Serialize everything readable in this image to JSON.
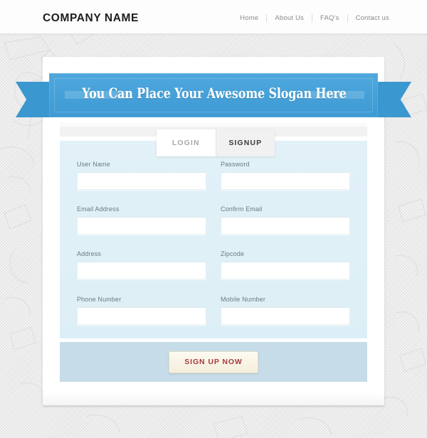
{
  "header": {
    "logo": "COMPANY NAME",
    "nav": [
      {
        "label": "Home"
      },
      {
        "label": "About Us"
      },
      {
        "label": "FAQ's"
      },
      {
        "label": "Contact us"
      }
    ]
  },
  "ribbon": {
    "slogan": "You Can Place Your Awesome Slogan Here",
    "color": "#4aa3da",
    "fold_color": "#2b76a5"
  },
  "tabs": [
    {
      "label": "LOGIN",
      "active": false
    },
    {
      "label": "SIGNUP",
      "active": true
    }
  ],
  "form": {
    "panel_color": "#dff0f7",
    "fields": [
      {
        "label": "User Name",
        "value": "",
        "placeholder": ""
      },
      {
        "label": "Password",
        "value": "",
        "placeholder": ""
      },
      {
        "label": "Email Address",
        "value": "",
        "placeholder": ""
      },
      {
        "label": "Confirm Email",
        "value": "",
        "placeholder": ""
      },
      {
        "label": "Address",
        "value": "",
        "placeholder": ""
      },
      {
        "label": "Zipcode",
        "value": "",
        "placeholder": ""
      },
      {
        "label": "Phone Number",
        "value": "",
        "placeholder": ""
      },
      {
        "label": "Mobile Number",
        "value": "",
        "placeholder": ""
      }
    ]
  },
  "actions": {
    "submit_label": "SIGN UP NOW",
    "submit_text_color": "#a63a3a",
    "strip_color": "#c6dce8"
  }
}
